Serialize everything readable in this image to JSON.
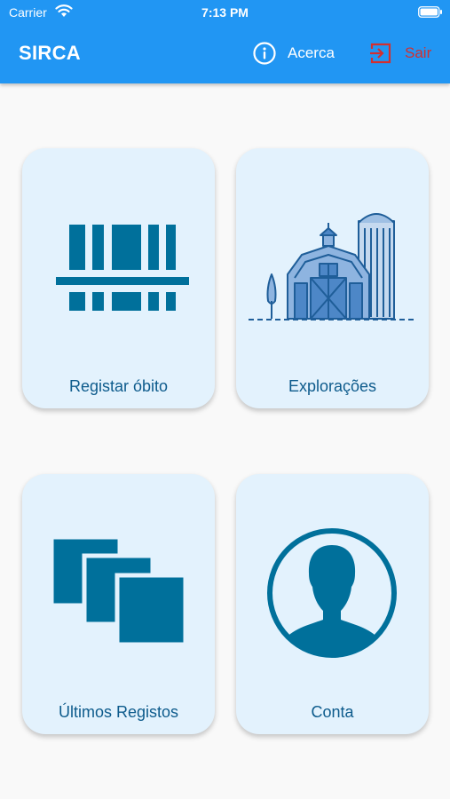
{
  "status_bar": {
    "carrier": "Carrier",
    "time": "7:13 PM"
  },
  "app_bar": {
    "title": "SIRCA",
    "about_label": "Acerca",
    "exit_label": "Sair",
    "about_icon": "info-icon",
    "exit_icon": "exit-icon"
  },
  "tiles": [
    {
      "label": "Registar óbito",
      "icon": "barcode-icon"
    },
    {
      "label": "Explorações",
      "icon": "farm-icon"
    },
    {
      "label": "Últimos Registos",
      "icon": "stacked-squares-icon"
    },
    {
      "label": "Conta",
      "icon": "person-icon"
    }
  ],
  "colors": {
    "app_bar": "#2196f3",
    "tile_background": "#e3f2fd",
    "icon_primary": "#00709b",
    "exit_red": "#d32f2f",
    "tile_text": "#0d5b8c"
  }
}
